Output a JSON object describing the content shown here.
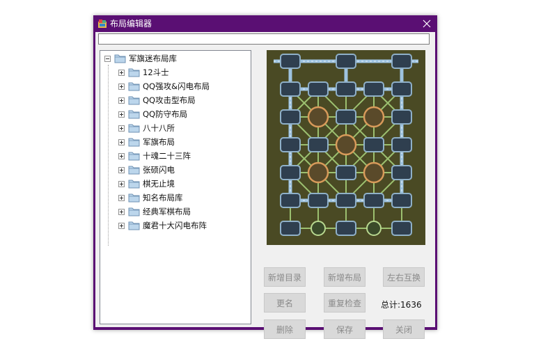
{
  "window": {
    "title": "布局编辑器",
    "border_color": "#5a0f73"
  },
  "path_input": {
    "value": ""
  },
  "tree": {
    "root": {
      "label": "军旗迷布局库",
      "expanded": true
    },
    "items": [
      {
        "label": "12斗士"
      },
      {
        "label": "QQ强攻&闪电布局"
      },
      {
        "label": "QQ攻击型布局"
      },
      {
        "label": "QQ防守布局"
      },
      {
        "label": "八十八所"
      },
      {
        "label": "军旗布局"
      },
      {
        "label": "十魂二十三阵"
      },
      {
        "label": "张硕闪电"
      },
      {
        "label": "棋无止境"
      },
      {
        "label": "知名布局库"
      },
      {
        "label": "经典军棋布局"
      },
      {
        "label": "魔君十大闪电布阵"
      }
    ]
  },
  "buttons": {
    "new_dir": "新增目录",
    "new_layout": "新增布局",
    "swap_lr": "左右互换",
    "rename": "更名",
    "recheck": "重复检查",
    "delete": "删除",
    "save": "保存",
    "close": "关闭"
  },
  "total": {
    "label": "总计:",
    "value": "1636"
  },
  "icons": {
    "app": "app-icon",
    "close": "close-icon",
    "folder": "folder-icon",
    "expander": "expander-icon"
  },
  "colors": {
    "board_bg": "#4a4a24",
    "rail": "#9ec3e0",
    "post": "#8fb0c8",
    "camp": "#d89a5a",
    "road": "#9cc070"
  }
}
